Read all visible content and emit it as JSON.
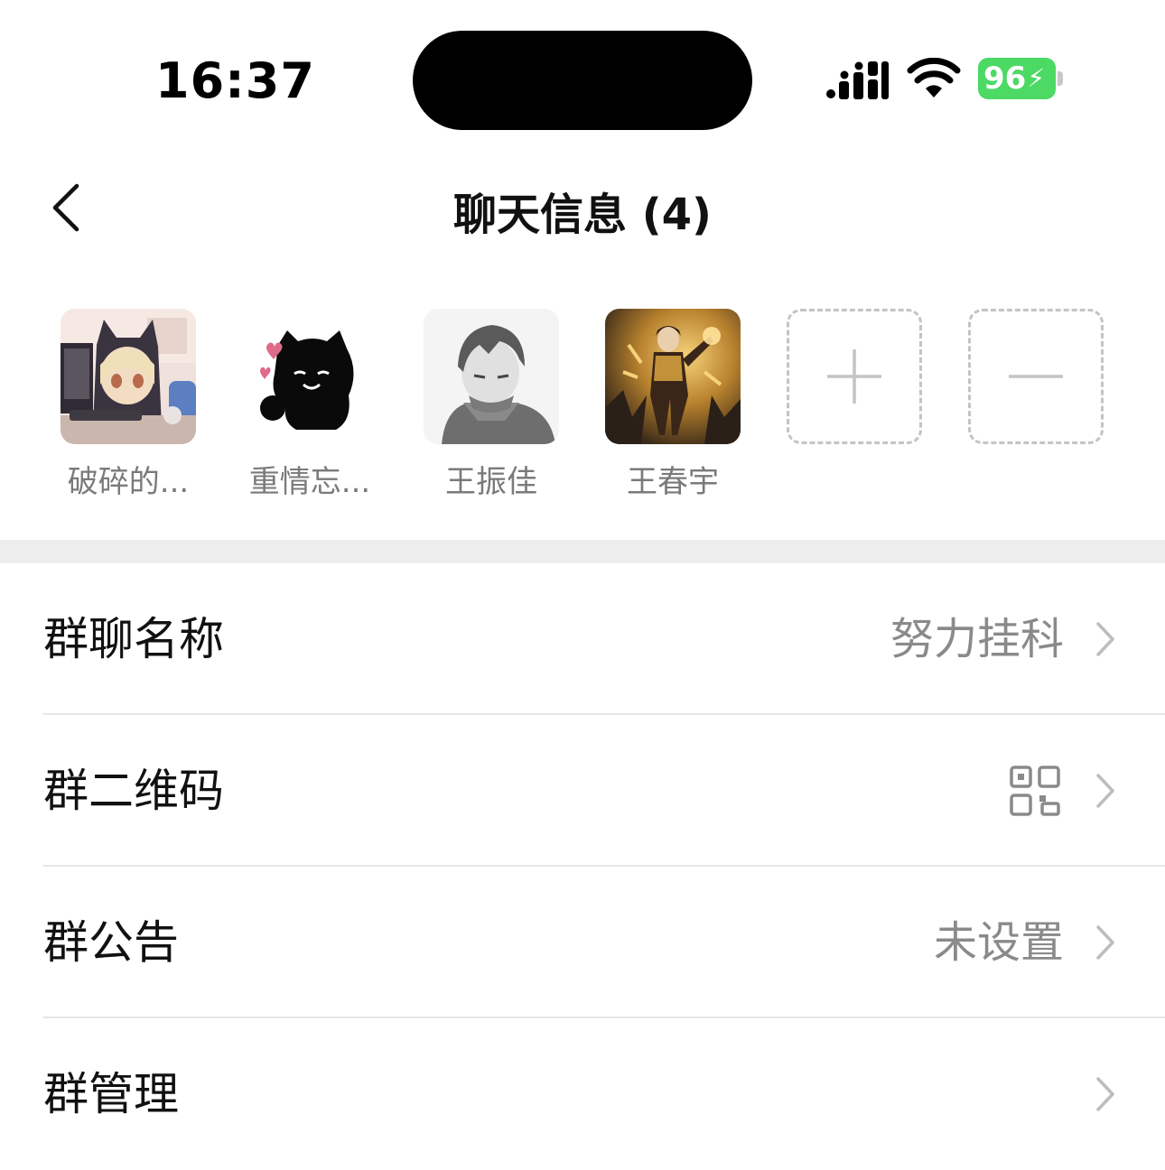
{
  "status_bar": {
    "time": "16:37",
    "battery_level": "96",
    "battery_color": "#4cd964",
    "icons": [
      "cellular-signal-icon",
      "wifi-icon",
      "battery-charging-icon"
    ]
  },
  "nav": {
    "back_icon": "chevron-left-icon",
    "title": "聊天信息 (4)"
  },
  "members": [
    {
      "name": "破碎的...",
      "avatar": "anime-girl-cat-hood-avatar"
    },
    {
      "name": "重情忘...",
      "avatar": "black-cat-silhouette-avatar"
    },
    {
      "name": "王振佳",
      "avatar": "grayscale-anime-boy-avatar"
    },
    {
      "name": "王春宇",
      "avatar": "golden-game-character-avatar"
    }
  ],
  "member_actions": {
    "add_icon": "plus-icon",
    "remove_icon": "minus-icon"
  },
  "settings": [
    {
      "label": "群聊名称",
      "value": "努力挂科"
    },
    {
      "label": "群二维码",
      "value_icon": "qr-code-icon"
    },
    {
      "label": "群公告",
      "value": "未设置"
    },
    {
      "label": "群管理",
      "value": ""
    }
  ]
}
